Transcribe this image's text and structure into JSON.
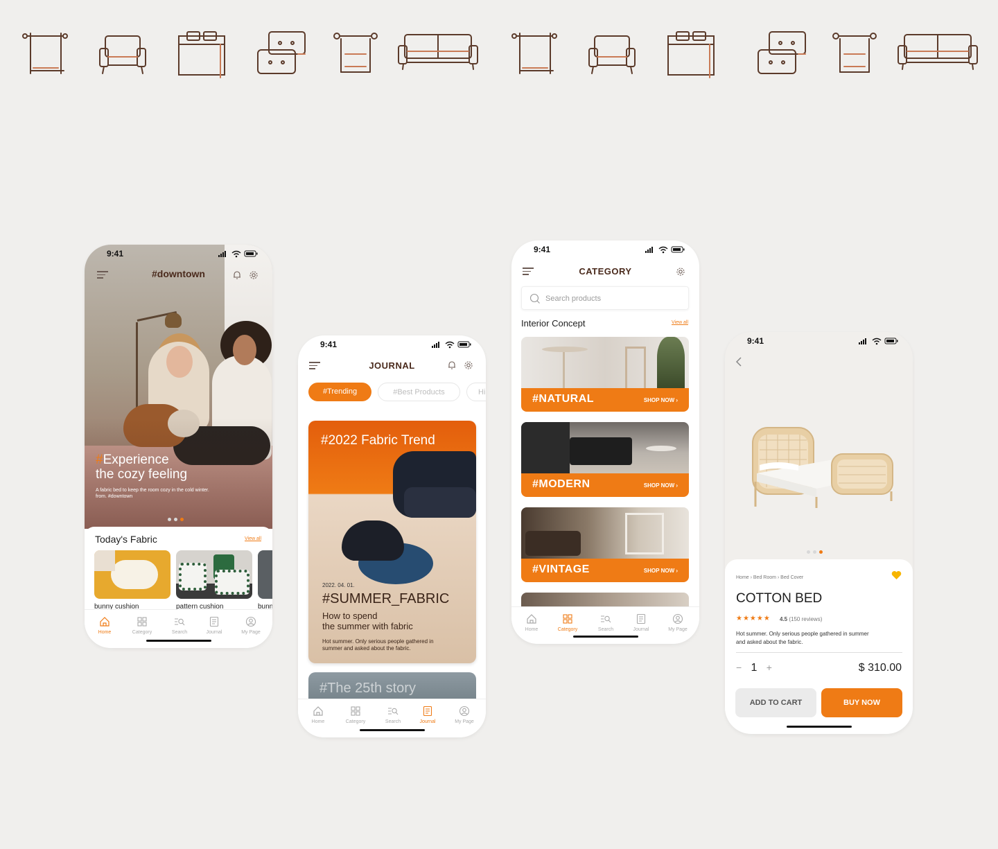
{
  "colors": {
    "accent": "#ef7b15",
    "brown": "#4a2a1c",
    "icon_stroke": "#5b3a2a",
    "icon_accent": "#c97a55",
    "background": "#f0efed"
  },
  "icon_strip": [
    "armchair-frame-icon",
    "armchair-icon",
    "bed-icon",
    "cushions-icon",
    "curtain-rod-icon",
    "sofa-icon",
    "armchair-frame-icon",
    "armchair-icon",
    "bed-icon",
    "cushions-icon",
    "curtain-rod-icon",
    "sofa-icon"
  ],
  "status_time": "9:41",
  "tabbar": [
    "Home",
    "Category",
    "Search",
    "Journal",
    "My Page"
  ],
  "home": {
    "title": "#downtown",
    "hero": {
      "hash": "#",
      "line1": "Experience",
      "line2": "the cozy feeling",
      "desc": "A fabric bed to keep the room cozy in the cold winter. from. #downtown"
    },
    "section_title": "Today's Fabric",
    "view_all": "View all",
    "products": [
      "bunny cushion",
      "pattern cushion",
      "bunny"
    ]
  },
  "journal": {
    "title": "JOURNAL",
    "chips": [
      "#Trending",
      "#Best Products",
      "Hi"
    ],
    "card": {
      "title": "#2022 Fabric Trend",
      "date": "2022. 04. 01.",
      "headline": "#SUMMER_FABRIC",
      "sub1": "How to spend",
      "sub2": "the summer with fabric",
      "desc": "Hot summer. Only serious people gathered in summer and asked about the fabric."
    },
    "card2_title": "#The 25th story"
  },
  "category": {
    "title": "CATEGORY",
    "search_placeholder": "Search products",
    "section_title": "Interior Concept",
    "view_all": "View all",
    "concepts": [
      {
        "label": "#NATURAL",
        "shop": "SHOP NOW ›"
      },
      {
        "label": "#MODERN",
        "shop": "SHOP NOW ›"
      },
      {
        "label": "#VINTAGE",
        "shop": "SHOP NOW ›"
      }
    ]
  },
  "product": {
    "breadcrumb": "Home › Bed Room › Bed Cover",
    "name": "COTTON BED",
    "stars": "★★★★★",
    "rating": "4.5",
    "reviews": "(150 reviews)",
    "desc": "Hot summer. Only serious people gathered in summer and asked about the fabric.",
    "quantity": "1",
    "minus": "−",
    "plus": "+",
    "price": "$ 310.00",
    "add_to_cart": "ADD TO CART",
    "buy_now": "BUY NOW"
  }
}
